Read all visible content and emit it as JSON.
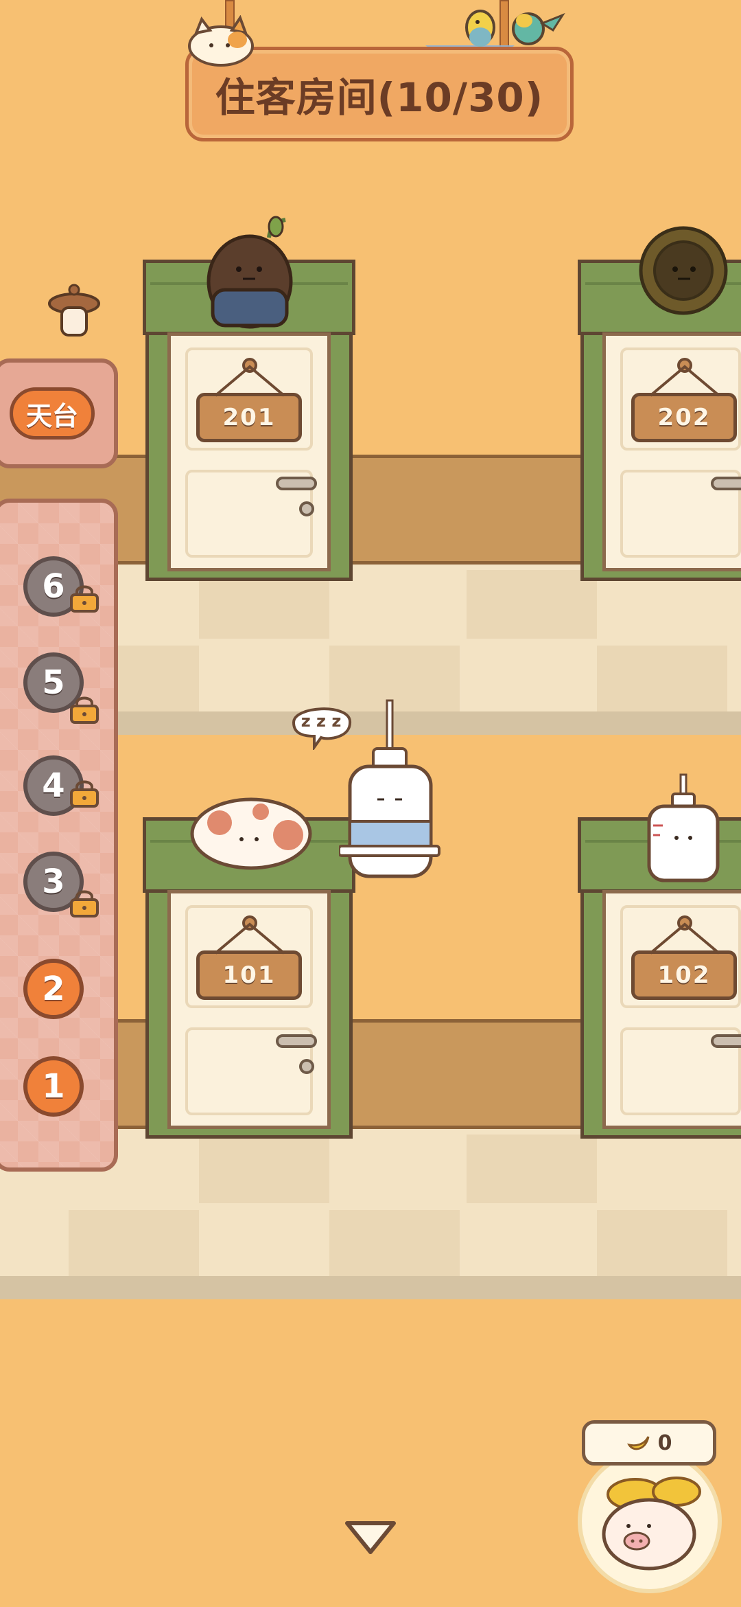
{
  "header": {
    "title": "住客房间(10/30)"
  },
  "sidebar": {
    "roof_label": "天台",
    "floors": [
      {
        "label": "6",
        "locked": true
      },
      {
        "label": "5",
        "locked": true
      },
      {
        "label": "4",
        "locked": true
      },
      {
        "label": "3",
        "locked": true
      },
      {
        "label": "2",
        "locked": false
      },
      {
        "label": "1",
        "locked": false
      }
    ]
  },
  "rooms": {
    "r201": "201",
    "r202": "202",
    "r101": "101",
    "r102": "102"
  },
  "speech": {
    "sleep_text": "z z z"
  },
  "bank": {
    "coin_count": "0",
    "coin_icon": "banana-coin-icon"
  },
  "colors": {
    "background": "#f7c072",
    "accent": "#f0813a",
    "door_frame": "#7f9a55"
  }
}
